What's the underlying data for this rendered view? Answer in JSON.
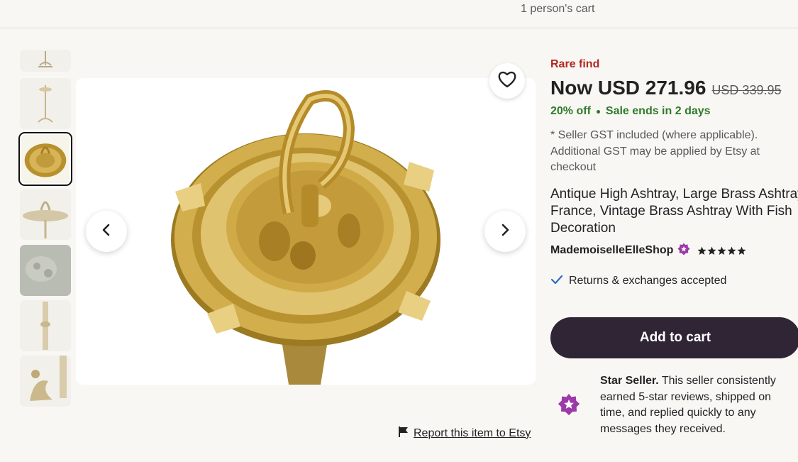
{
  "header": {
    "cart_count_text": "1 person's cart"
  },
  "gallery": {
    "thumbnails": [
      "thumb-stand-top",
      "thumb-stand-full",
      "thumb-ashtray-top",
      "thumb-ashtray-side",
      "thumb-relief-closeup",
      "thumb-stem",
      "thumb-fish-base"
    ],
    "selected_index": 2
  },
  "listing": {
    "badge": "Rare find",
    "price_now": "Now USD 271.96",
    "price_original": "USD 339.95",
    "discount": "20% off",
    "sale_ends": "Sale ends in 2 days",
    "gst_note": "* Seller GST included (where applicable). Additional GST may be applied by Etsy at checkout",
    "title": "Antique High Ashtray, Large Brass Ashtray France, Vintage Brass Ashtray With Fish Decoration",
    "shop_name": "MademoiselleElleShop",
    "rating_stars": 5,
    "returns": "Returns & exchanges accepted",
    "add_to_cart": "Add to cart"
  },
  "star_seller": {
    "label": "Star Seller.",
    "text": " This seller consistently earned 5-star reviews, shipped on time, and replied quickly to any messages they received."
  },
  "report": {
    "label": "Report this item to Etsy"
  },
  "colors": {
    "badge_red": "#b3261e",
    "sale_green": "#2f7a2a",
    "cart_button": "#2f2535",
    "star_seller_purple": "#9b3aa8",
    "brass": "#c9a23a"
  }
}
